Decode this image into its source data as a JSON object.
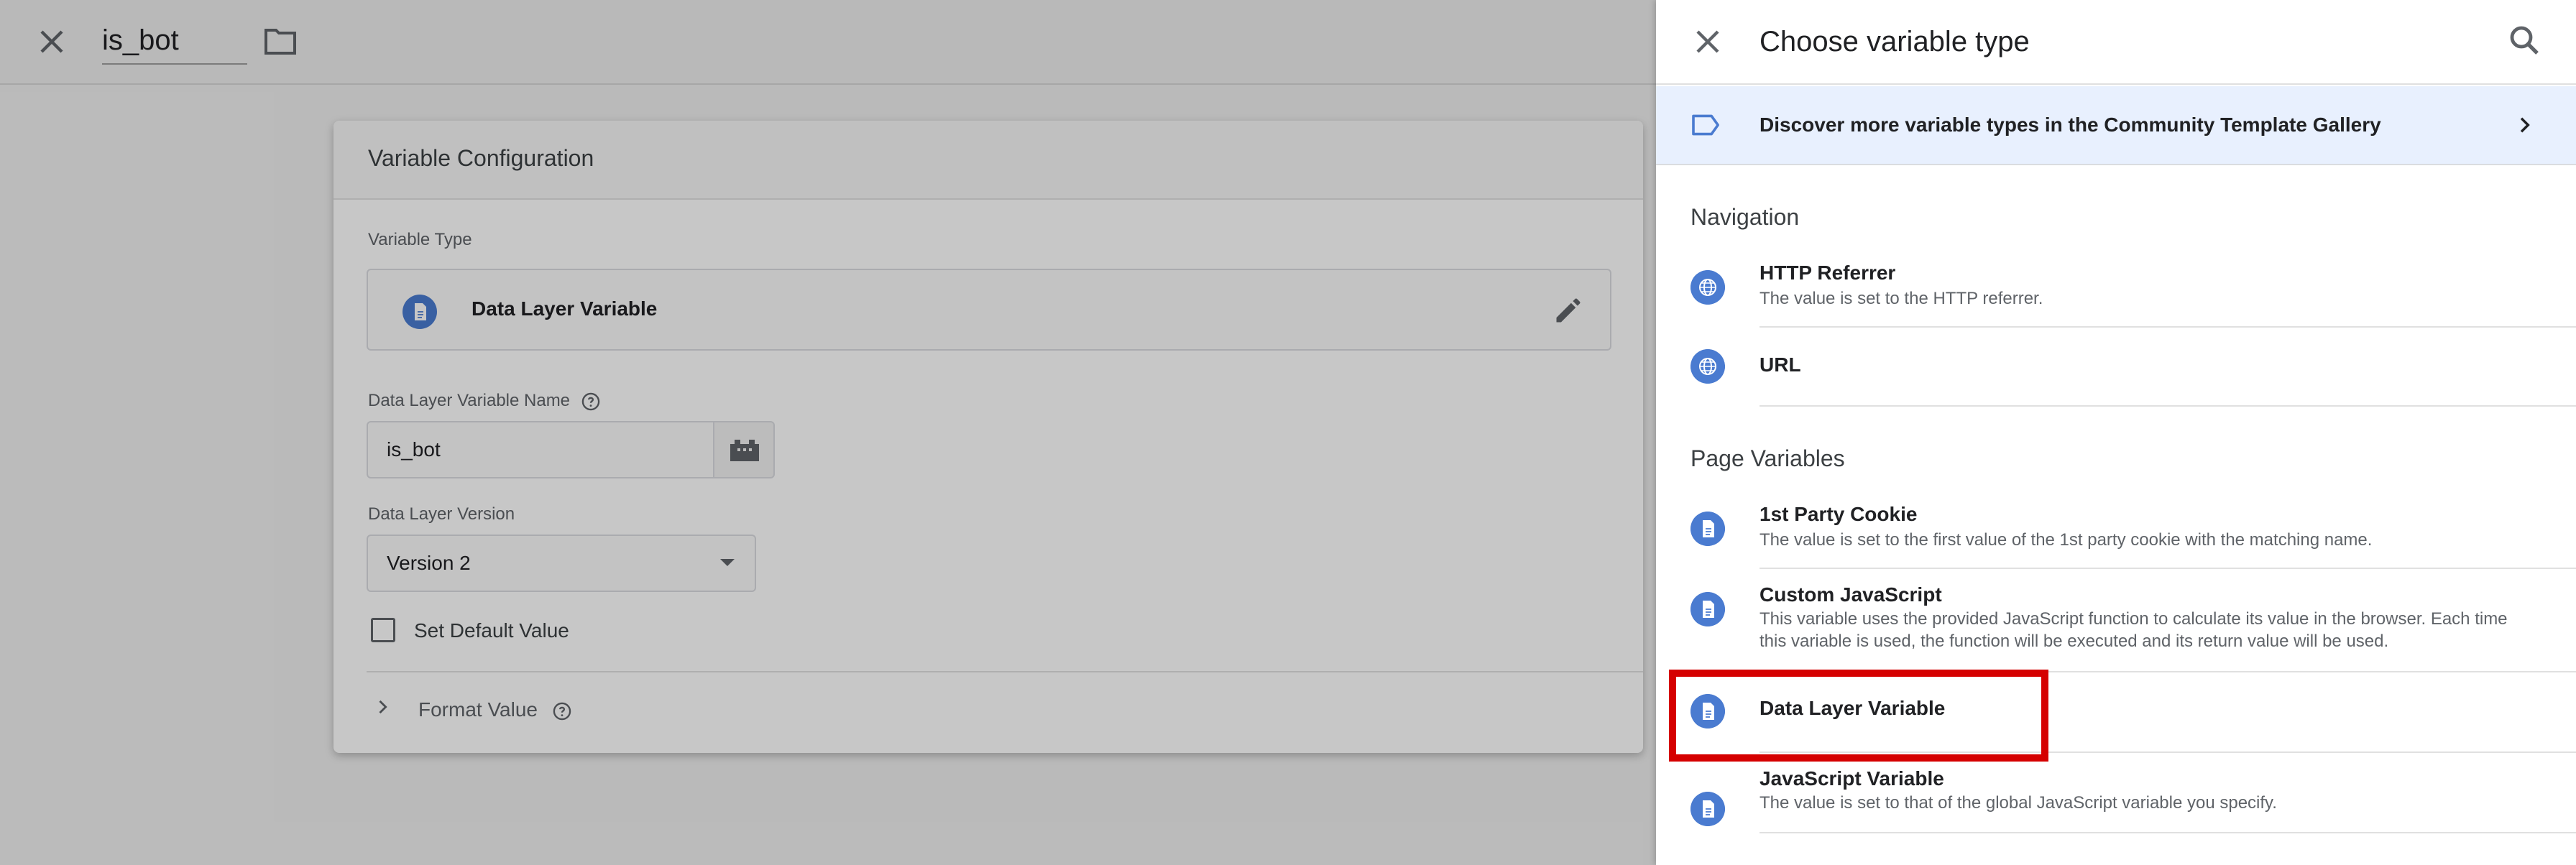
{
  "editor": {
    "variable_name": "is_bot",
    "card_title": "Variable Configuration",
    "variable_type_label": "Variable Type",
    "variable_type_value": "Data Layer Variable",
    "dlv_name_label": "Data Layer Variable Name",
    "dlv_name_value": "is_bot",
    "version_label": "Data Layer Version",
    "version_value": "Version 2",
    "default_value_label": "Set Default Value",
    "format_value_label": "Format Value"
  },
  "panel": {
    "title": "Choose variable type",
    "gallery_text": "Discover more variable types in the Community Template Gallery",
    "sections": [
      {
        "title": "Navigation",
        "items": [
          {
            "title": "HTTP Referrer",
            "desc": "The value is set to the HTTP referrer.",
            "icon": "globe-icon"
          },
          {
            "title": "URL",
            "desc": "",
            "icon": "globe-icon"
          }
        ]
      },
      {
        "title": "Page Variables",
        "items": [
          {
            "title": "1st Party Cookie",
            "desc": "The value is set to the first value of the 1st party cookie with the matching name.",
            "icon": "document-icon"
          },
          {
            "title": "Custom JavaScript",
            "desc": "This variable uses the provided JavaScript function to calculate its value in the browser. Each time this variable is used, the function will be executed and its return value will be used.",
            "icon": "document-icon"
          },
          {
            "title": "Data Layer Variable",
            "desc": "",
            "icon": "document-icon"
          },
          {
            "title": "JavaScript Variable",
            "desc": "The value is set to that of the global JavaScript variable you specify.",
            "icon": "document-icon"
          }
        ]
      }
    ]
  },
  "colors": {
    "accent_blue": "#4a7bd0",
    "highlight_red": "#d50000",
    "gallery_bg": "#e8f0fe"
  }
}
